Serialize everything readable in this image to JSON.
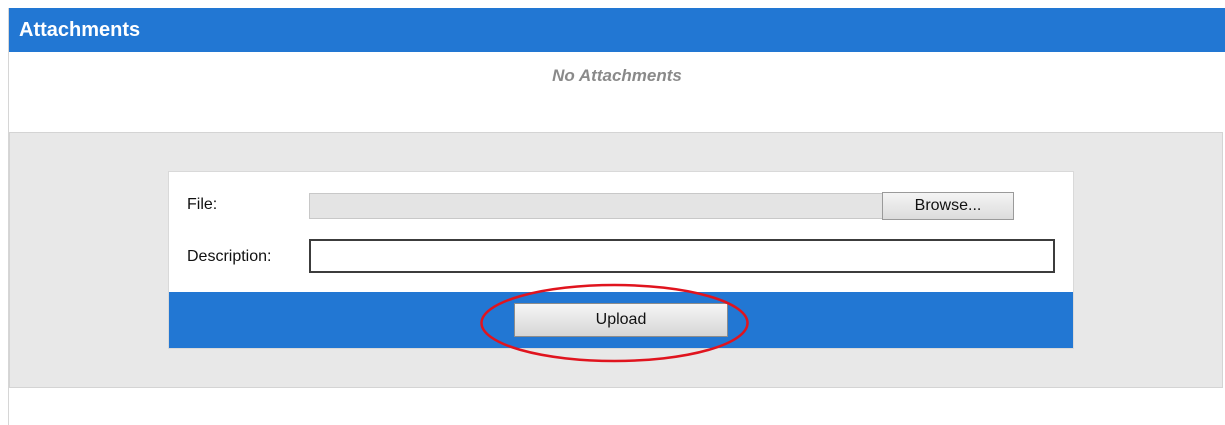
{
  "header": {
    "title": "Attachments"
  },
  "attachments": {
    "empty_message": "No Attachments"
  },
  "form": {
    "file_label": "File:",
    "browse_label": "Browse...",
    "description_label": "Description:",
    "upload_label": "Upload"
  },
  "colors": {
    "header_blue": "#2277d3",
    "highlight_red": "#e0141e",
    "panel_gray": "#e8e8e8"
  }
}
